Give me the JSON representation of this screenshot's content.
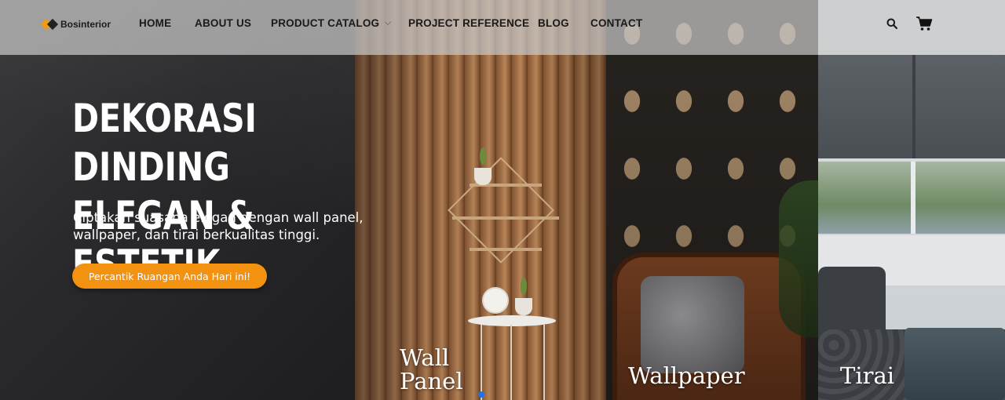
{
  "header": {
    "logo_text": "Bosinterior",
    "nav": [
      {
        "label": "HOME"
      },
      {
        "label": "ABOUT US"
      },
      {
        "label": "PRODUCT CATALOG",
        "has_dropdown": true
      },
      {
        "label": "PROJECT REFERENCE"
      },
      {
        "label": "BLOG"
      },
      {
        "label": "CONTACT"
      }
    ],
    "icons": [
      "search-icon",
      "cart-icon"
    ]
  },
  "hero": {
    "title_line1": "DEKORASI DINDING",
    "title_line2": "ELEGAN & ESTETIK",
    "subtitle_line1": "Ciptakan suasana elegan dengan wall panel,",
    "subtitle_line2": "wallpaper, dan tirai berkualitas tinggi.",
    "cta_label": "Percantik Ruangan Anda Hari ini!"
  },
  "categories": [
    {
      "label_line1": "Wall",
      "label_line2": "Panel"
    },
    {
      "label": "Wallpaper"
    },
    {
      "label": "Tirai"
    }
  ],
  "slider": {
    "active_index": 1
  },
  "colors": {
    "accent": "#f39111",
    "header_bg": "#c8c8c8",
    "dark_bg": "#2a2a2d",
    "dot": "#1e73e8"
  }
}
